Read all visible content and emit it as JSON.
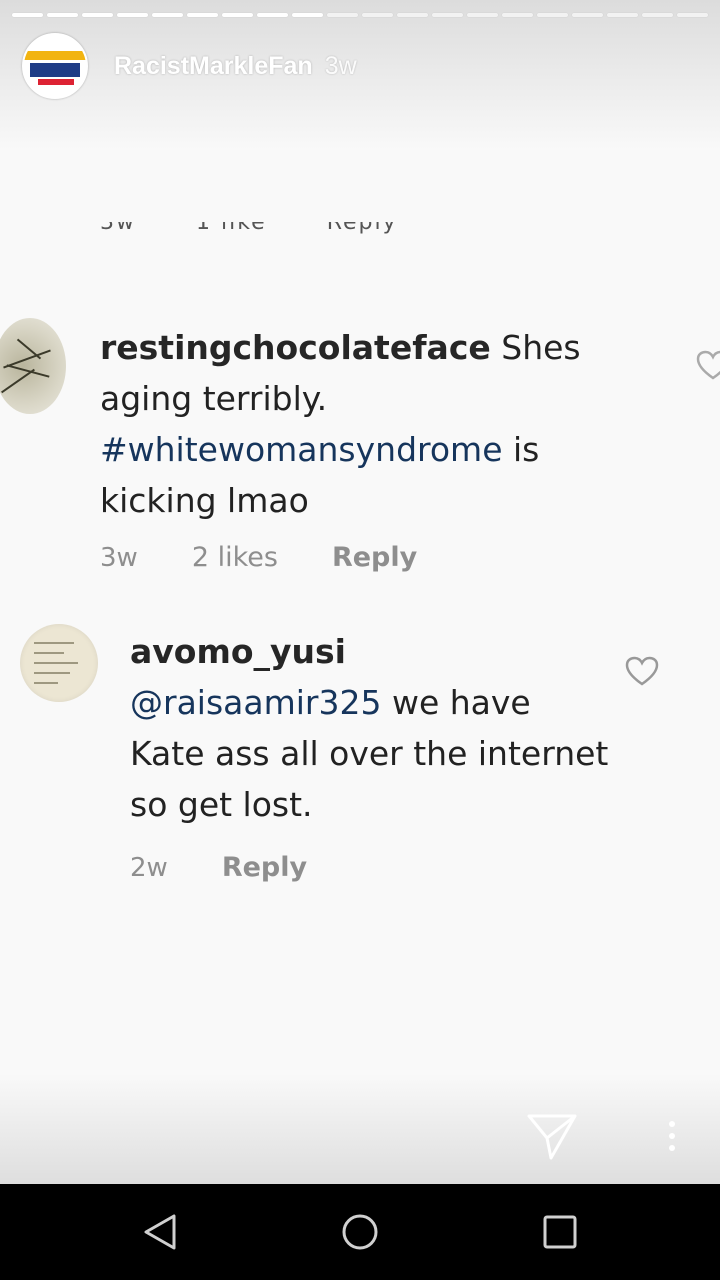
{
  "story": {
    "username": "RacistMarkleFan",
    "time": "3w",
    "progress_segments": 20,
    "progress_done": 9
  },
  "comments": [
    {
      "username": "restingchocolateface",
      "text_before": "Shes aging terribly.",
      "hashtag": "#whitewomansyndrome",
      "text_after": "is kicking lmao",
      "time": "3w",
      "likes": "2 likes",
      "reply": "Reply"
    },
    {
      "username": "avomo_yusi",
      "mention": "@raisaamir325",
      "text": "we have Kate ass all over the internet so get lost.",
      "time": "2w",
      "reply": "Reply"
    }
  ],
  "colors": {
    "hashtag": "#16355c",
    "meta_text": "#8e8e8e",
    "navbar": "#000000"
  },
  "icons": {
    "send": "send-paper-plane-icon",
    "more": "more-vertical-icon",
    "heart": "heart-outline-icon",
    "nav_back": "back-triangle-icon",
    "nav_home": "home-circle-icon",
    "nav_recent": "recent-apps-square-icon"
  }
}
